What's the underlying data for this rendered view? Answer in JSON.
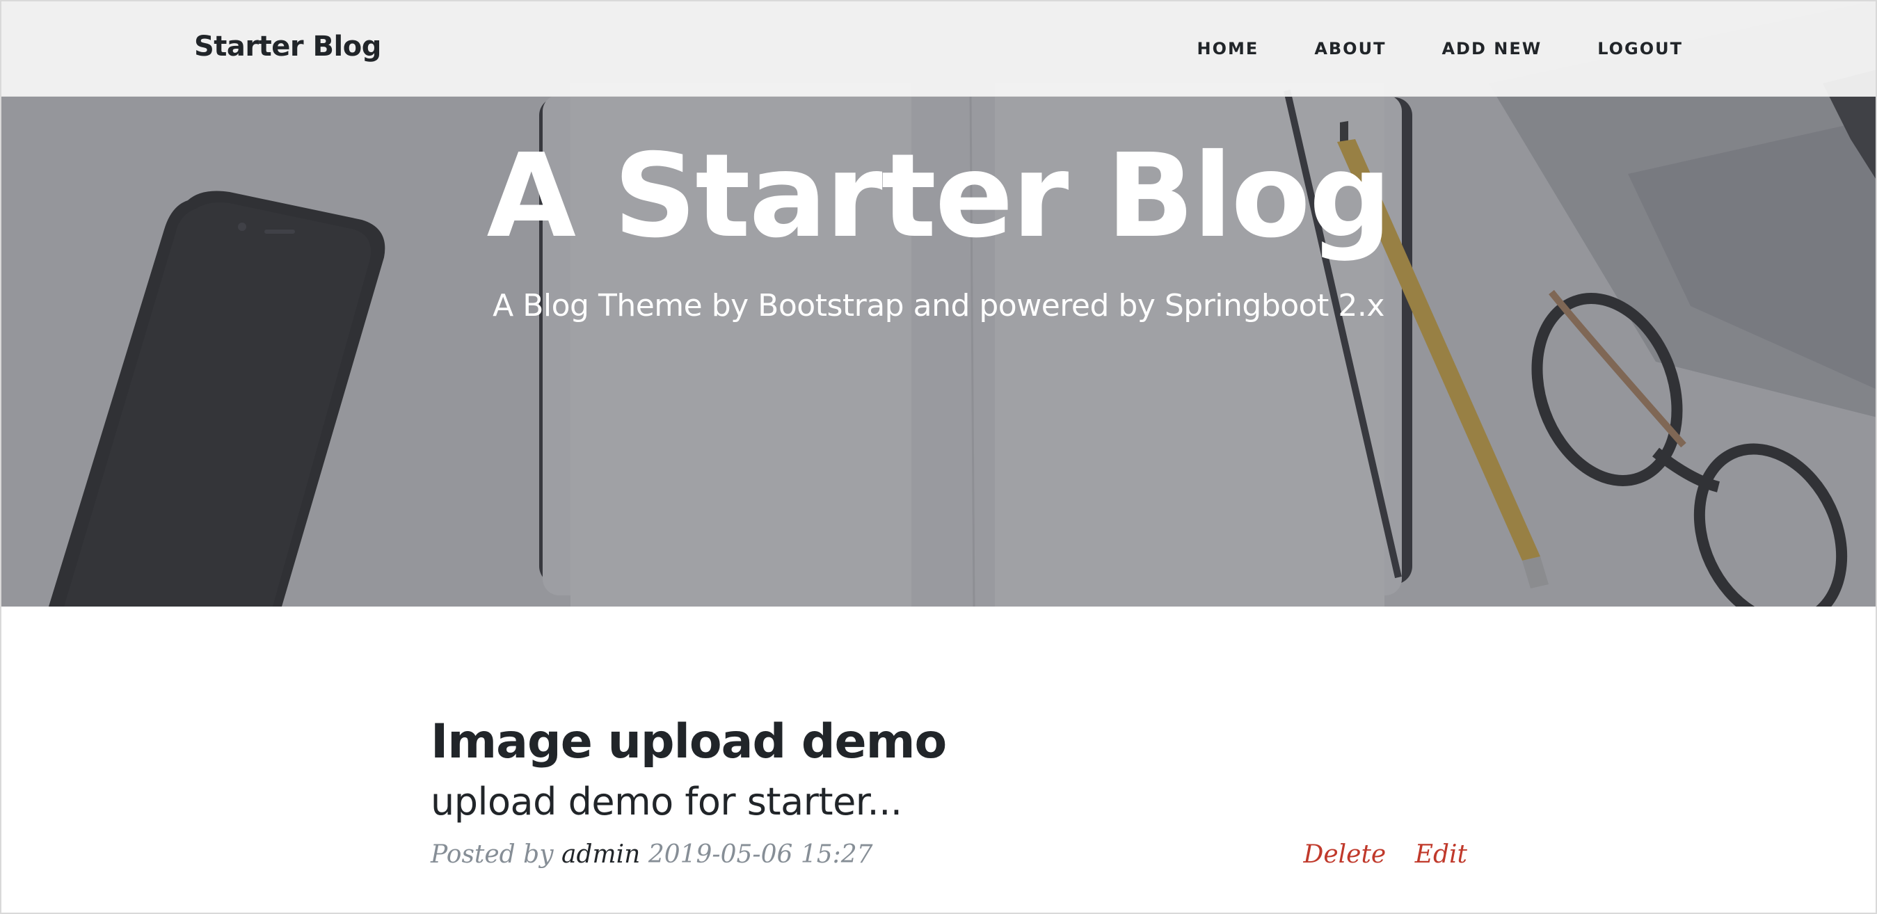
{
  "navbar": {
    "brand": "Starter Blog",
    "links": [
      {
        "label": "HOME"
      },
      {
        "label": "ABOUT"
      },
      {
        "label": "ADD NEW"
      },
      {
        "label": "LOGOUT"
      }
    ]
  },
  "hero": {
    "title": "A Starter Blog",
    "subtitle": "A Blog Theme by Bootstrap and powered by Springboot 2.x"
  },
  "post": {
    "title": "Image upload demo",
    "subtitle": "upload demo for starter...",
    "meta_prefix": "Posted by",
    "author": "admin",
    "timestamp": "2019-05-06 15:27",
    "actions": {
      "delete": "Delete",
      "edit": "Edit"
    }
  },
  "colors": {
    "text_dark": "#212529",
    "text_muted": "#868e96",
    "action_red": "#c0392b",
    "navbar_bg": "#f5f5f5"
  }
}
